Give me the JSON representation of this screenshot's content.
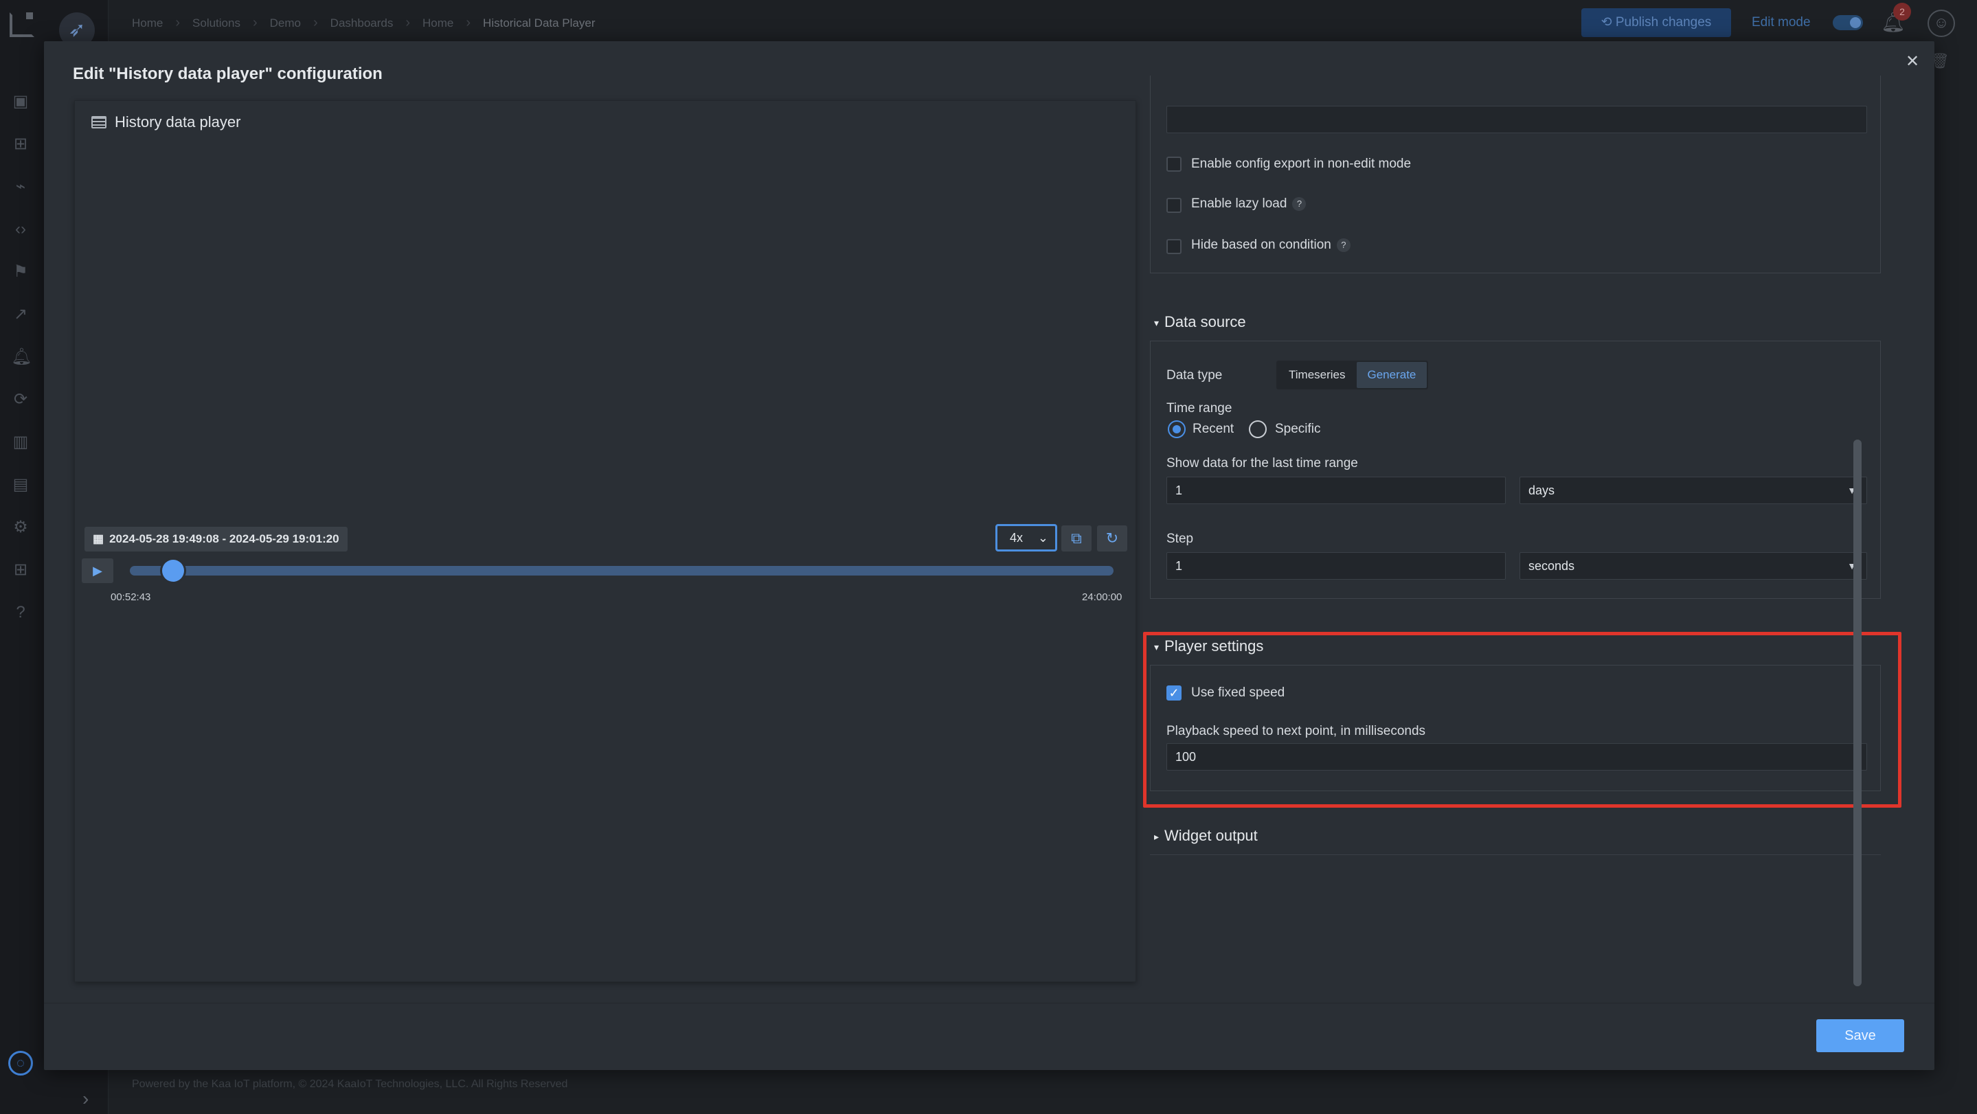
{
  "breadcrumbs": [
    "Home",
    "Solutions",
    "Demo",
    "Dashboards",
    "Home",
    "Historical Data Player"
  ],
  "topbar": {
    "publish_label": "Publish changes",
    "edit_mode_label": "Edit mode",
    "edit_mode_on": true,
    "notifications_count": "2"
  },
  "footer": "Powered by the Kaa IoT platform, © 2024 KaaIoT Technologies, LLC. All Rights Reserved",
  "modal": {
    "title": "Edit \"History data player\" configuration",
    "save_label": "Save"
  },
  "preview": {
    "widget_title": "History data player",
    "date_range": "2024-05-28 19:49:08 - 2024-05-29 19:01:20",
    "speed": "4x",
    "time_current": "00:52:43",
    "time_end": "24:00:00",
    "progress": 0.037
  },
  "config": {
    "enable_config_export_label": "Enable config export in non-edit mode",
    "enable_config_export": false,
    "enable_lazy_load_label": "Enable lazy load",
    "enable_lazy_load": false,
    "hide_on_condition_label": "Hide based on condition",
    "hide_on_condition": false,
    "help_symbol": "?",
    "data_source": {
      "title": "Data source",
      "data_type_label": "Data type",
      "data_type_options": [
        "Timeseries",
        "Generate"
      ],
      "data_type_selected": "Generate",
      "time_range_label": "Time range",
      "time_range_options": [
        "Recent",
        "Specific"
      ],
      "time_range_selected": "Recent",
      "last_range_label": "Show data for the last time range",
      "last_range_value": "1",
      "last_range_unit": "days",
      "step_label": "Step",
      "step_value": "1",
      "step_unit": "seconds"
    },
    "player_settings": {
      "title": "Player settings",
      "use_fixed_speed_label": "Use fixed speed",
      "use_fixed_speed": true,
      "playback_speed_label": "Playback speed to next point, in milliseconds",
      "playback_speed_value": "100"
    },
    "widget_output": {
      "title": "Widget output"
    }
  },
  "colors": {
    "accent": "#4a8fe5",
    "highlight": "#e0352b",
    "modal_bg": "#2a2f35"
  }
}
